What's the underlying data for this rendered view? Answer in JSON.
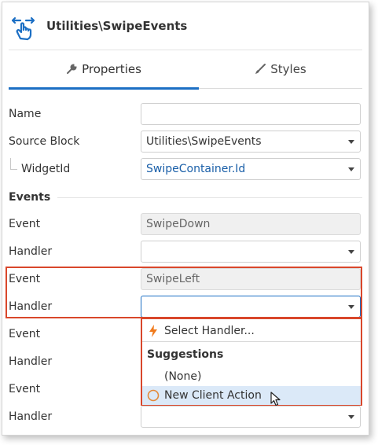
{
  "header": {
    "title": "Utilities\\SwipeEvents",
    "icon": "swipe-hand-icon"
  },
  "tabs": [
    {
      "label": "Properties",
      "icon": "wrench-icon",
      "active": true
    },
    {
      "label": "Styles",
      "icon": "brush-icon",
      "active": false
    }
  ],
  "properties": {
    "name": {
      "label": "Name",
      "value": ""
    },
    "source_block": {
      "label": "Source Block",
      "value": "Utilities\\SwipeEvents"
    },
    "widget_id": {
      "label": "WidgetId",
      "value": "SwipeContainer.Id"
    }
  },
  "events_section": {
    "title": "Events",
    "rows": [
      {
        "event_label": "Event",
        "event_value": "SwipeDown",
        "handler_label": "Handler",
        "handler_value": ""
      },
      {
        "event_label": "Event",
        "event_value": "SwipeLeft",
        "handler_label": "Handler",
        "handler_value": ""
      },
      {
        "event_label": "Event",
        "event_value": "",
        "handler_label": "Handler",
        "handler_value": ""
      },
      {
        "event_label": "Event",
        "event_value": "",
        "handler_label": "Handler",
        "handler_value": ""
      }
    ]
  },
  "dropdown": {
    "select_handler": "Select Handler...",
    "suggestions_header": "Suggestions",
    "none_option": "(None)",
    "new_action_option": "New Client Action"
  },
  "colors": {
    "accent": "#1c6fc4",
    "highlight": "#d9472b",
    "link": "#1a5fa8",
    "lightning": "#f07a1c",
    "hover": "#dbe9f8"
  }
}
